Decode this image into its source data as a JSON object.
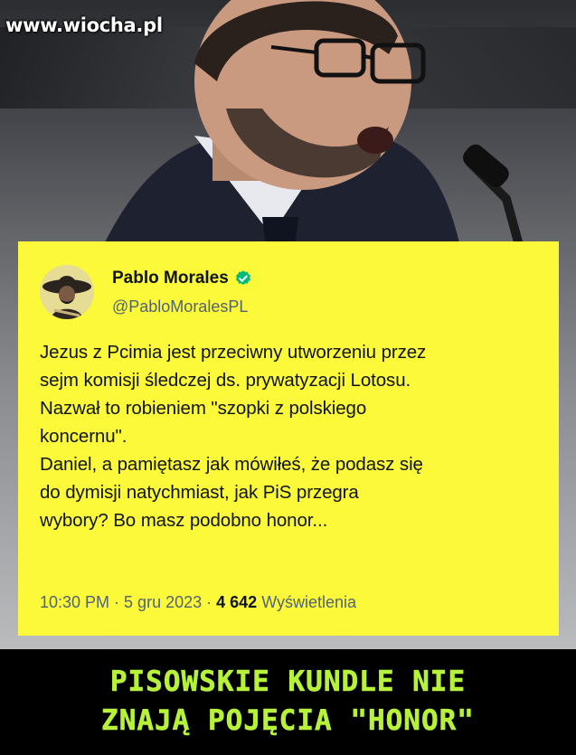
{
  "watermark": "www.wiocha.pl",
  "tweet": {
    "display_name": "Pablo Morales",
    "handle": "@PabloMoralesPL",
    "text": "Jezus z Pcimia jest przeciwny utworzeniu przez\nsejm komisji śledczej ds. prywatyzacji Lotosu.\nNazwał to robieniem \"szopki z polskiego\nkoncernu\".\nDaniel, a pamiętasz jak mówiłeś, że podasz się\ndo dymisji natychmiast, jak PiS przegra\nwybory? Bo masz podobno honor...",
    "time": "10:30 PM",
    "separator": " · ",
    "date": "5 gru 2023",
    "views_count": "4 642",
    "views_label": "Wyświetlenia",
    "verified_icon": "verified-badge-icon"
  },
  "caption": {
    "line1": "PISOWSKIE KUNDLE NIE",
    "line2": "ZNAJĄ POJĘCIA \"HONOR\""
  },
  "colors": {
    "card_background": "#fbf93a",
    "caption_text": "#b7f23a",
    "verified_badge": "#00ba7c"
  }
}
